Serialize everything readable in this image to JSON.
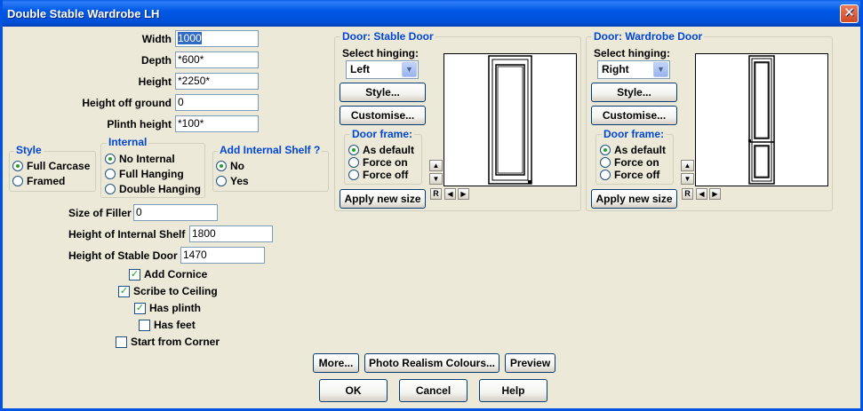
{
  "window": {
    "title": "Double Stable Wardrobe LH",
    "close_glyph": "✕"
  },
  "dimensions": {
    "width_label": "Width",
    "width_value": "1000",
    "depth_label": "Depth",
    "depth_value": "*600*",
    "height_label": "Height",
    "height_value": "*2250*",
    "hog_label": "Height off ground",
    "hog_value": "0",
    "plinth_label": "Plinth height",
    "plinth_value": "*100*"
  },
  "style_group": {
    "title": "Style",
    "options": [
      "Full Carcase",
      "Framed"
    ],
    "selected": 0
  },
  "internal_group": {
    "title": "Internal",
    "options": [
      "No Internal",
      "Full Hanging",
      "Double Hanging"
    ],
    "selected": 0
  },
  "shelf_group": {
    "title": "Add Internal Shelf ?",
    "options": [
      "No",
      "Yes"
    ],
    "selected": 0
  },
  "extras": {
    "filler_label": "Size of Filler",
    "filler_value": "0",
    "shelf_height_label": "Height of Internal Shelf",
    "shelf_height_value": "1800",
    "stable_height_label": "Height of Stable Door",
    "stable_height_value": "1470"
  },
  "checks": [
    {
      "label": "Add Cornice",
      "checked": true
    },
    {
      "label": "Scribe to Ceiling",
      "checked": true
    },
    {
      "label": "Has plinth",
      "checked": true
    },
    {
      "label": "Has feet",
      "checked": false
    },
    {
      "label": "Start from Corner",
      "checked": false
    }
  ],
  "door_stable": {
    "title": "Door: Stable Door",
    "hinging_label": "Select hinging:",
    "hinging_value": "Left",
    "style_btn": "Style...",
    "customise_btn": "Customise...",
    "frame_title": "Door frame:",
    "frame_options": [
      "As default",
      "Force on",
      "Force off"
    ],
    "apply_btn": "Apply new size"
  },
  "door_wardrobe": {
    "title": "Door: Wardrobe Door",
    "hinging_label": "Select hinging:",
    "hinging_value": "Right",
    "style_btn": "Style...",
    "customise_btn": "Customise...",
    "frame_title": "Door frame:",
    "frame_options": [
      "As default",
      "Force on",
      "Force off"
    ],
    "apply_btn": "Apply new size"
  },
  "preview_controls": {
    "reset": "R",
    "left": "◀",
    "right": "▶",
    "up": "▲",
    "down": "▼"
  },
  "bottom_buttons": {
    "more": "More...",
    "colours": "Photo Realism Colours...",
    "preview": "Preview",
    "ok": "OK",
    "cancel": "Cancel",
    "help": "Help"
  },
  "colors": {
    "title_bar": "#0058e6",
    "group_title": "#0046d5",
    "face": "#ece9d8",
    "check_mark": "#21a121"
  }
}
